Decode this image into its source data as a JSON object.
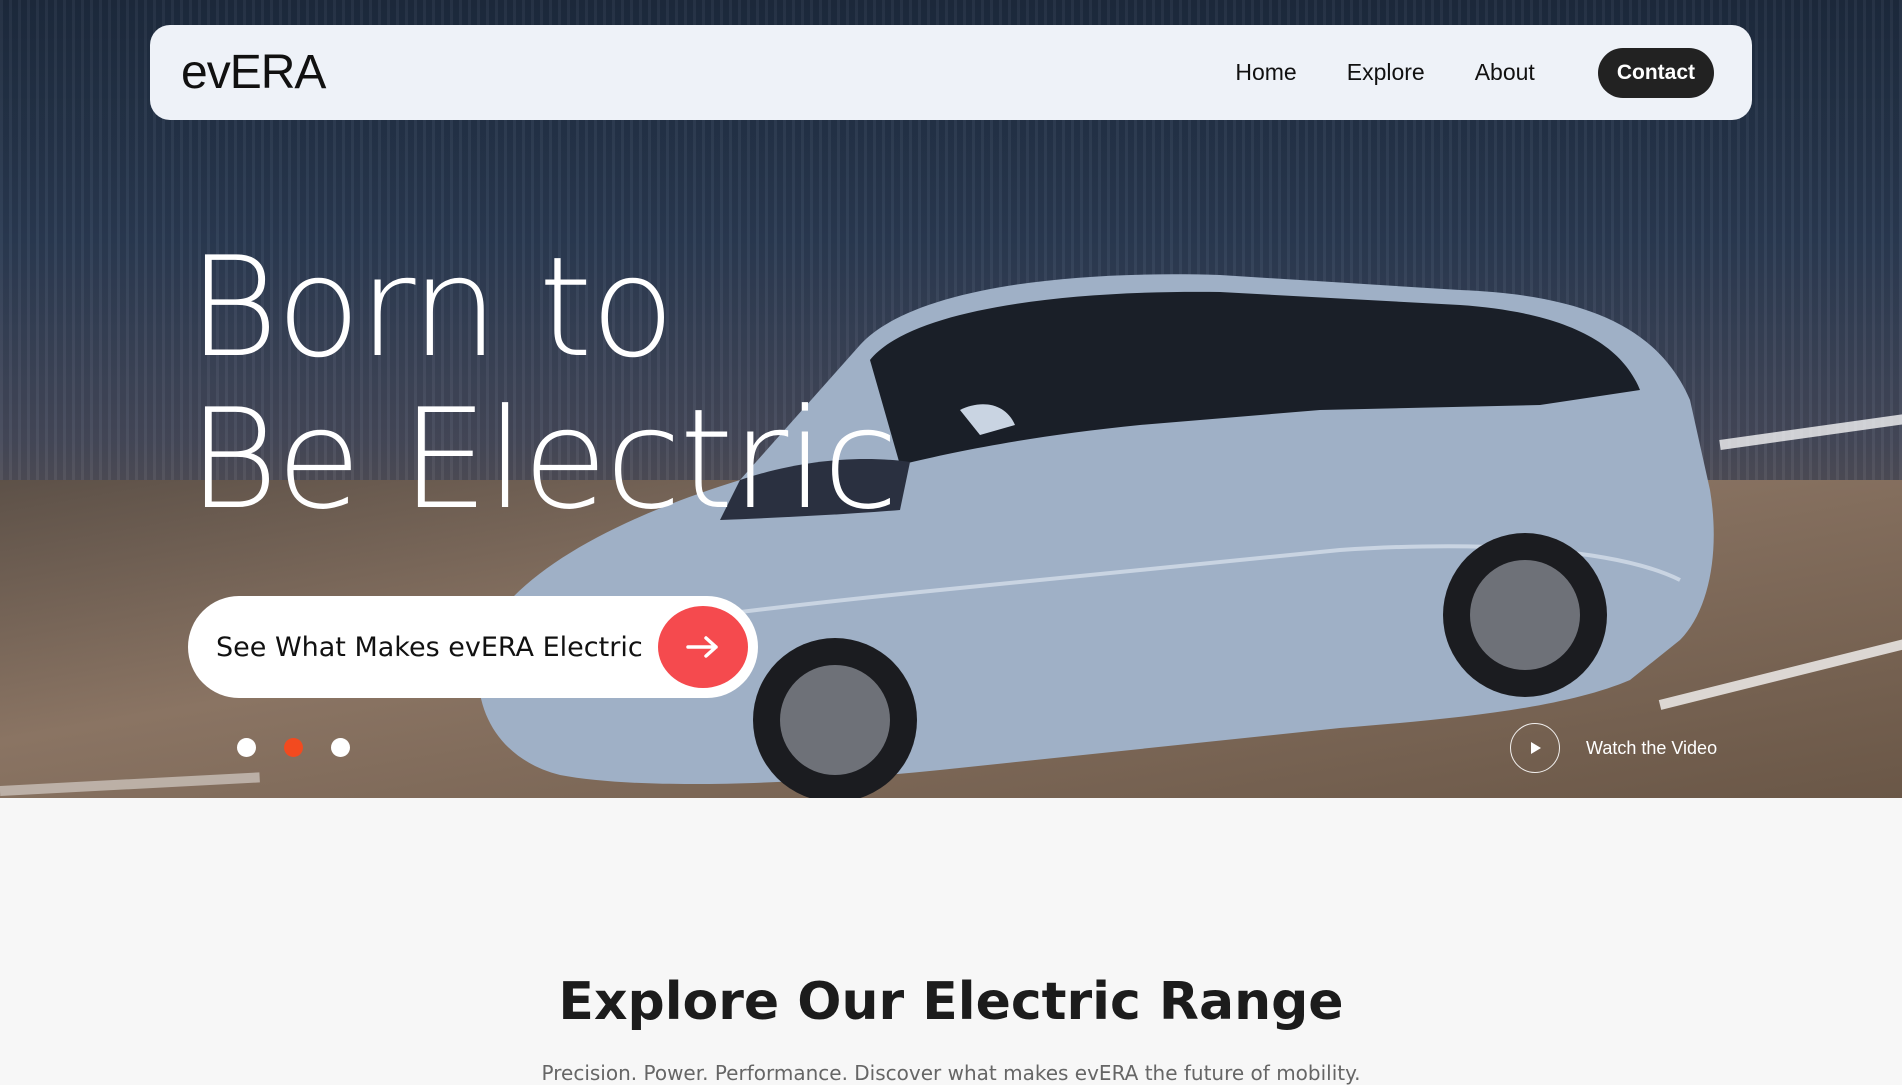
{
  "brand": {
    "logo": "evERA"
  },
  "nav": {
    "links": [
      "Home",
      "Explore",
      "About"
    ],
    "contact_label": "Contact"
  },
  "hero": {
    "headline_line1": "Born to",
    "headline_line2": "Be Electric",
    "cta_label": "See What Makes evERA Electric",
    "slider": {
      "count": 3,
      "active_index": 1
    },
    "video_label": "Watch the Video"
  },
  "section": {
    "title": "Explore Our Electric Range",
    "subtitle": "Precision. Power. Performance. Discover what makes evERA the future of mobility."
  },
  "colors": {
    "accent": "#f54a4e",
    "active_dot": "#f24a1f",
    "nav_bg": "#eef2f8",
    "contact_bg": "#222222"
  },
  "icons": {
    "cta": "arrow-right-icon",
    "video": "play-icon"
  }
}
